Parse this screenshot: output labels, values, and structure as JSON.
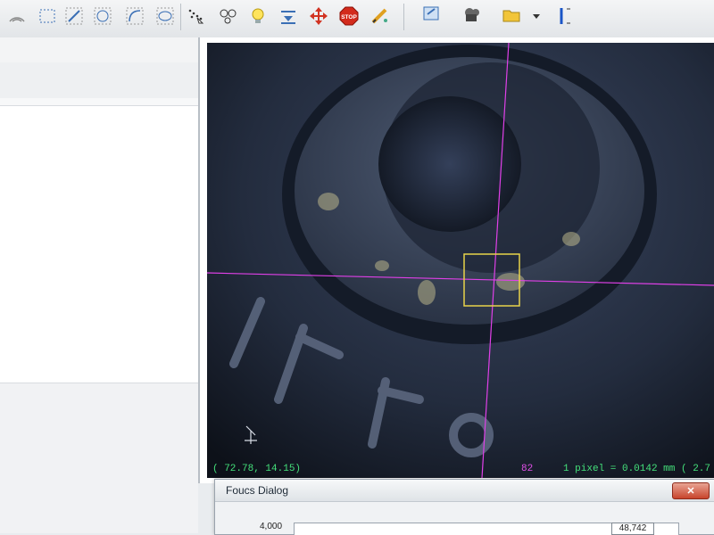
{
  "toolbar": {
    "icons": [
      "wifi-icon",
      "dotted-rect-select-icon",
      "line-select-icon",
      "dotted-circle-select-icon",
      "arc-select-icon",
      "ellipse-select-icon",
      "point-select-icon",
      "circles-icon",
      "lightbulb-icon",
      "align-icon",
      "move-cross-icon",
      "stop-icon",
      "pencil-icon"
    ],
    "stop_label": "STOP"
  },
  "camera": {
    "status_left": "( 72.78,  14.15)",
    "status_mid": "82",
    "status_right": "1 pixel = 0.0142 mm  ( 2.7",
    "crosshair_color": "#e040e8",
    "focus_box_color": "#e8d34a"
  },
  "focus_dialog": {
    "title": "Foucs Dialog",
    "close_label": "✕",
    "y_axis_label": "4,000",
    "readout": "48,742"
  }
}
